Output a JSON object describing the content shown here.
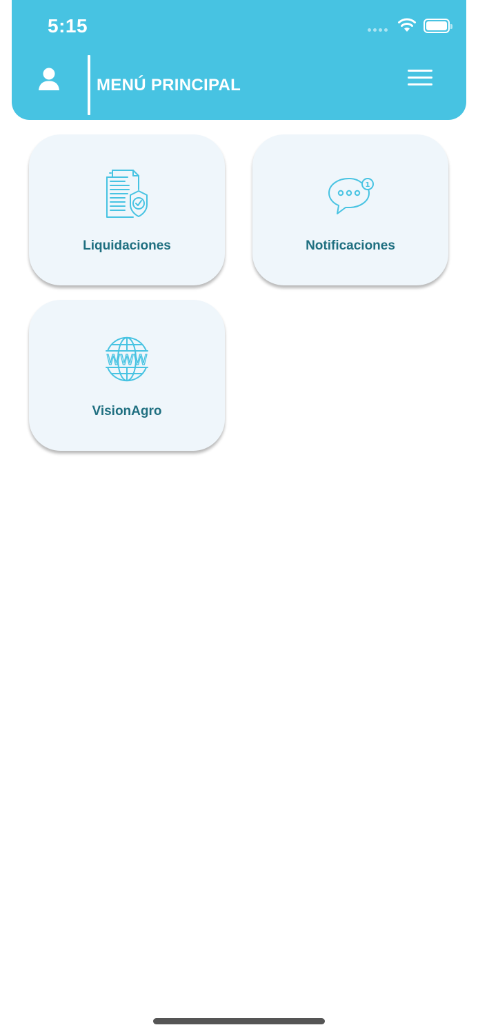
{
  "status_bar": {
    "time": "5:15",
    "icons": [
      "signal-icon",
      "wifi-icon",
      "battery-icon"
    ]
  },
  "header": {
    "title": "MENÚ PRINCIPAL",
    "left_icon": "user-icon",
    "right_icon": "menu-icon"
  },
  "colors": {
    "header_bg": "#47c3e2",
    "card_bg": "#eff6fb",
    "card_label": "#1f6f80",
    "icon_stroke": "#47c3e2"
  },
  "menu": {
    "items": [
      {
        "label": "Liquidaciones",
        "icon": "document-shield-icon"
      },
      {
        "label": "Notificaciones",
        "icon": "chat-notification-icon",
        "badge": "1"
      },
      {
        "label": "VisionAgro",
        "icon": "globe-www-icon",
        "icon_text": "WWW"
      }
    ]
  }
}
